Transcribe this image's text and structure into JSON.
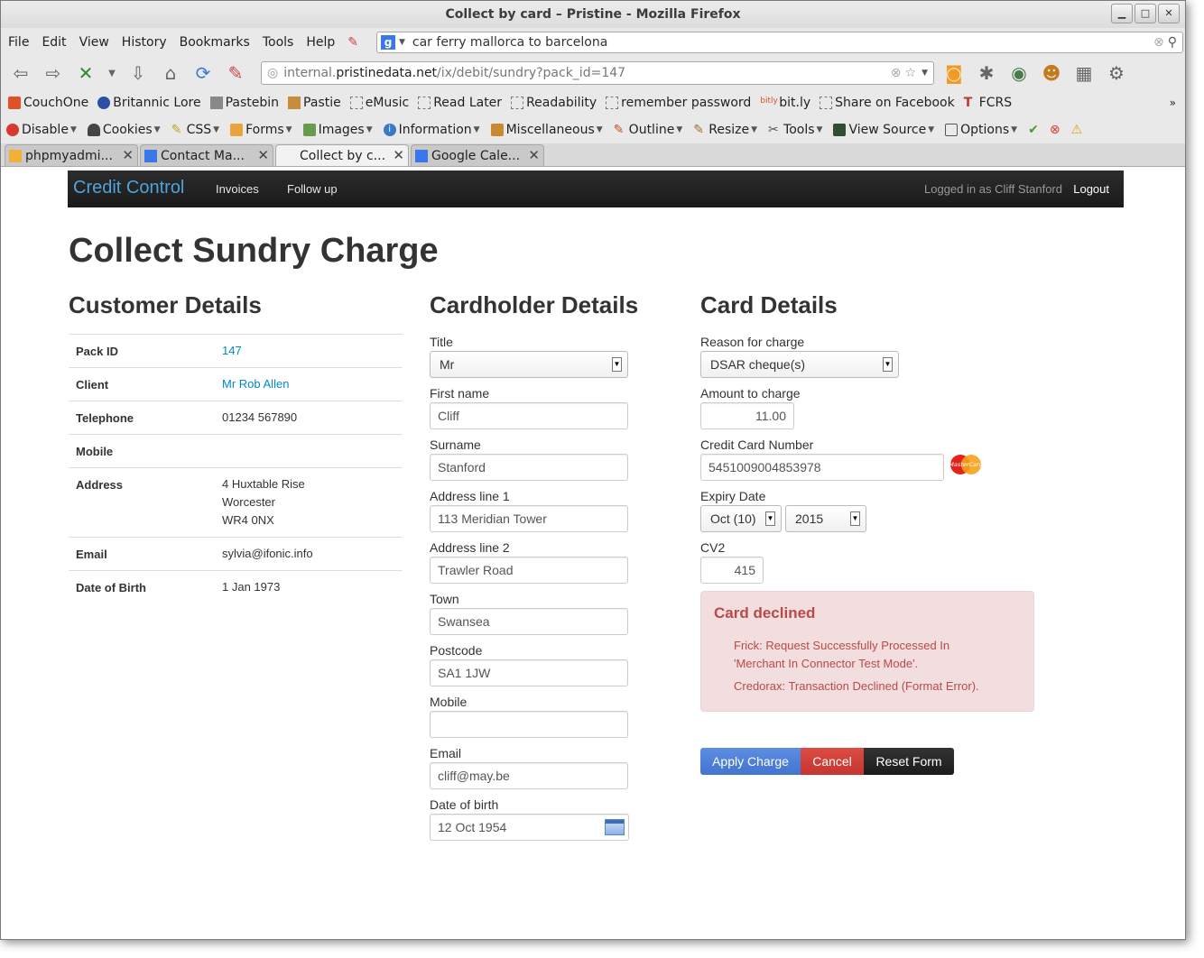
{
  "browser": {
    "title": "Collect by card – Pristine - Mozilla Firefox",
    "menu": [
      "File",
      "Edit",
      "View",
      "History",
      "Bookmarks",
      "Tools",
      "Help"
    ],
    "search_value": "car ferry mallorca to barcelona",
    "url_prefix": "internal.",
    "url_domain": "pristinedata.net",
    "url_path": "/ix/debit/sundry?pack_id=147",
    "bookmarks": [
      "CouchOne",
      "Britannic Lore",
      "Pastebin",
      "Pastie",
      "eMusic",
      "Read Later",
      "Readability",
      "remember password",
      "bit.ly",
      "Share on Facebook",
      "FCRS"
    ],
    "devtools": [
      "Disable",
      "Cookies",
      "CSS",
      "Forms",
      "Images",
      "Information",
      "Miscellaneous",
      "Outline",
      "Resize",
      "Tools",
      "View Source",
      "Options"
    ],
    "tabs": [
      "phpmyadmi...",
      "Contact Ma...",
      "Collect by c...",
      "Google Cale..."
    ]
  },
  "nav": {
    "brand": "Credit Control",
    "links": [
      "Invoices",
      "Follow up"
    ],
    "logged_in": "Logged in as Cliff Stanford",
    "logout": "Logout"
  },
  "page_title": "Collect Sundry Charge",
  "customer": {
    "heading": "Customer Details",
    "rows": [
      {
        "label": "Pack ID",
        "value": "147"
      },
      {
        "label": "Client",
        "value": "Mr Rob Allen"
      },
      {
        "label": "Telephone",
        "value": "01234 567890"
      },
      {
        "label": "Mobile",
        "value": ""
      },
      {
        "label": "Address",
        "lines": [
          "4 Huxtable Rise",
          "Worcester",
          "WR4 0NX"
        ]
      },
      {
        "label": "Email",
        "value": "sylvia@ifonic.info"
      },
      {
        "label": "Date of Birth",
        "value": "1 Jan 1973"
      }
    ]
  },
  "cardholder": {
    "heading": "Cardholder Details",
    "title_label": "Title",
    "title_value": "Mr",
    "first_label": "First name",
    "first_value": "Cliff",
    "surname_label": "Surname",
    "surname_value": "Stanford",
    "addr1_label": "Address line 1",
    "addr1_value": "113 Meridian Tower",
    "addr2_label": "Address line 2",
    "addr2_value": "Trawler Road",
    "town_label": "Town",
    "town_value": "Swansea",
    "postcode_label": "Postcode",
    "postcode_value": "SA1 1JW",
    "mobile_label": "Mobile",
    "mobile_value": "",
    "email_label": "Email",
    "email_value": "cliff@may.be",
    "dob_label": "Date of birth",
    "dob_value": "12 Oct 1954"
  },
  "card": {
    "heading": "Card Details",
    "reason_label": "Reason for charge",
    "reason_value": "DSAR cheque(s)",
    "amount_label": "Amount to charge",
    "amount_value": "11.00",
    "number_label": "Credit Card Number",
    "number_value": "5451009004853978",
    "card_logo": "MasterCard",
    "expiry_label": "Expiry Date",
    "expiry_month": "Oct (10)",
    "expiry_year": "2015",
    "cv2_label": "CV2",
    "cv2_value": "415"
  },
  "alert": {
    "title": "Card declined",
    "msg1_line1": "Frick: Request Successfully Processed In",
    "msg1_line2": "'Merchant In Connector Test Mode'.",
    "msg2": "Credorax: Transaction Declined (Format Error)."
  },
  "buttons": {
    "apply": "Apply Charge",
    "cancel": "Cancel",
    "reset": "Reset Form"
  },
  "colors": {
    "apply": "#4d7fd9",
    "cancel": "#d2413a",
    "reset": "#222222",
    "brand": "#4fa3dc",
    "alert_bg": "#f2dede",
    "alert_text": "#b94a48"
  }
}
